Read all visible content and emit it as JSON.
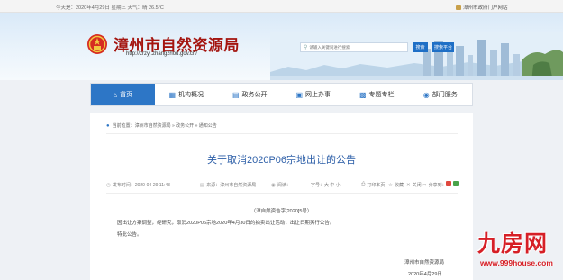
{
  "topbar": {
    "today": "今天是：2020年4月29日 星期三   天气：晴 26.5°C",
    "portal_link": "漳州市政府门户网站"
  },
  "header": {
    "site_title": "漳州市自然资源局",
    "site_url": "http://zrzyj.zhangzhou.gov.cn/",
    "search_placeholder": "请输入关键词进行搜索",
    "search_button": "搜索",
    "platform_button": "搜索平台"
  },
  "nav": {
    "items": [
      {
        "label": "首页",
        "icon": "home-icon"
      },
      {
        "label": "机构概况",
        "icon": "building-icon"
      },
      {
        "label": "政务公开",
        "icon": "document-icon"
      },
      {
        "label": "网上办事",
        "icon": "monitor-icon"
      },
      {
        "label": "专题专栏",
        "icon": "grid-icon"
      },
      {
        "label": "部门服务",
        "icon": "service-icon"
      }
    ],
    "active_index": 0
  },
  "breadcrumb": "当前位置：漳州市自然资源局 » 政务公开 » 通知公告",
  "article": {
    "title": "关于取消2020P06宗地出让的公告",
    "meta": {
      "publish_time": "发布时间：2020-04-29 11:43",
      "source": "来源：漳州市自然资源局",
      "views": "阅读：",
      "font_size": "字号：大 中 小",
      "print": "打印本页",
      "favorite": "收藏",
      "close": "关闭",
      "share": "分享到："
    },
    "doc_number": "（漳自然资告字[2020]5号）",
    "paragraphs": [
      "因出让方案调整，经研究，取消2020P06宗地2020年4月30日的拍卖出让活动，出让日期另行公告。",
      "特此公告。"
    ],
    "signature": "漳州市自然资源局",
    "date": "2020年4月29日"
  },
  "watermark": {
    "brand": "九房网",
    "url": "www.999house.com"
  },
  "colors": {
    "brand_red": "#a4140f",
    "nav_blue": "#2d76c6",
    "title_blue": "#2d5fa8",
    "watermark_red": "#d61f26"
  }
}
